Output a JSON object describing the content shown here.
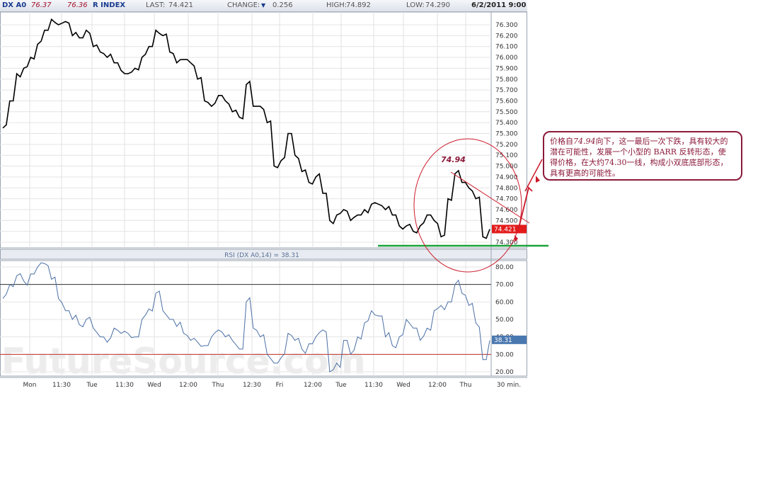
{
  "header": {
    "symbol": "DX A0",
    "value1": "76.37",
    "value2": "76.36",
    "name": "R INDEX",
    "last_label": "LAST:",
    "last_value": "74.421",
    "change_label": "CHANGE:",
    "change_value": "0.256",
    "high_label": "HIGH:",
    "high_value": "74.892",
    "low_label": "LOW:",
    "low_value": "74.290",
    "datetime": "6/2/2011 9:00"
  },
  "rsi_header": "RSI (DX A0,14) = 38.31",
  "watermark": "FutureSource.com",
  "colors": {
    "price_line": "#000000",
    "rsi_line": "#4a6fa5",
    "support_line": "#1aa33a",
    "annotation": "#cc1a2a",
    "rsi_badge": "#4a78b0",
    "price_badge": "#e31b1b"
  },
  "chart_data": [
    {
      "type": "line",
      "series_kind": "price",
      "y_ticks": [
        "76.300",
        "76.200",
        "76.100",
        "76.000",
        "75.900",
        "75.800",
        "75.700",
        "75.600",
        "75.500",
        "75.400",
        "75.300",
        "75.200",
        "75.100",
        "75.000",
        "74.900",
        "74.800",
        "74.700",
        "74.600",
        "74.500",
        "74.400",
        "74.300"
      ],
      "ylim": [
        74.26,
        76.41
      ],
      "last_badge": "74.421",
      "peak_label": "74.94",
      "support_level": 74.3,
      "x_ticks": [
        "Mon",
        "11:30",
        "Tue",
        "11:30",
        "Wed",
        "12:00",
        "Thu",
        "12:30",
        "Fri",
        "12:00",
        "Tue",
        "11:30",
        "Wed",
        "12:00",
        "Thu",
        "30 min."
      ],
      "x": [
        0,
        1,
        2,
        3,
        4,
        5,
        6,
        7,
        8,
        9,
        10,
        11,
        12,
        13,
        14,
        15,
        16,
        17,
        18,
        19,
        20,
        21,
        22,
        23,
        24,
        25,
        26,
        27,
        28,
        29,
        30,
        31,
        32,
        33,
        34,
        35,
        36,
        37,
        38,
        39,
        40,
        41,
        42,
        43,
        44,
        45,
        46,
        47,
        48,
        49,
        50,
        51,
        52,
        53,
        54,
        55,
        56,
        57,
        58,
        59,
        60,
        61,
        62,
        63,
        64,
        65,
        66,
        67,
        68,
        69,
        70
      ],
      "values": [
        75.35,
        75.6,
        75.85,
        75.9,
        76.0,
        76.12,
        76.25,
        76.35,
        76.3,
        76.33,
        76.2,
        76.18,
        76.25,
        76.1,
        76.05,
        76.0,
        75.95,
        75.88,
        75.85,
        75.9,
        76.0,
        76.1,
        76.25,
        76.2,
        76.05,
        75.95,
        75.98,
        75.95,
        75.8,
        75.6,
        75.55,
        75.65,
        75.6,
        75.5,
        75.45,
        75.75,
        75.55,
        75.55,
        75.4,
        75.0,
        75.05,
        75.3,
        75.1,
        74.95,
        74.85,
        74.9,
        74.75,
        74.5,
        74.55,
        74.6,
        74.5,
        74.55,
        74.6,
        74.65,
        74.65,
        74.6,
        74.55,
        74.45,
        74.45,
        74.4,
        74.45,
        74.55,
        74.5,
        74.35,
        74.7,
        74.93,
        74.85,
        74.8,
        74.7,
        74.35,
        74.42
      ]
    },
    {
      "type": "line",
      "series_kind": "rsi",
      "title": "RSI (DX A0,14) = 38.31",
      "y_ticks": [
        "80.00",
        "70.00",
        "60.00",
        "50.00",
        "40.00",
        "30.00",
        "20.00"
      ],
      "ylim": [
        19,
        83
      ],
      "reference_lines": [
        70,
        30
      ],
      "last_badge": "38.31",
      "x": [
        0,
        1,
        2,
        3,
        4,
        5,
        6,
        7,
        8,
        9,
        10,
        11,
        12,
        13,
        14,
        15,
        16,
        17,
        18,
        19,
        20,
        21,
        22,
        23,
        24,
        25,
        26,
        27,
        28,
        29,
        30,
        31,
        32,
        33,
        34,
        35,
        36,
        37,
        38,
        39,
        40,
        41,
        42,
        43,
        44,
        45,
        46,
        47,
        48,
        49,
        50,
        51,
        52,
        53,
        54,
        55,
        56,
        57,
        58,
        59,
        60,
        61,
        62,
        63,
        64,
        65,
        66,
        67,
        68,
        69,
        70
      ],
      "values": [
        62,
        70,
        75,
        72,
        76,
        80,
        82,
        73,
        62,
        55,
        50,
        47,
        50,
        45,
        40,
        37,
        45,
        42,
        42,
        40,
        50,
        56,
        65,
        55,
        50,
        46,
        42,
        38,
        37,
        35,
        40,
        44,
        40,
        38,
        33,
        60,
        45,
        40,
        30,
        25,
        28,
        42,
        38,
        33,
        36,
        40,
        44,
        20,
        25,
        38,
        30,
        40,
        48,
        55,
        52,
        40,
        35,
        40,
        50,
        45,
        38,
        45,
        55,
        58,
        60,
        70,
        65,
        58,
        48,
        27,
        38
      ]
    }
  ],
  "annotation": {
    "line1_pre": "价格自",
    "line1_num": "74.94",
    "line1_post": "向下，这一最后一次下跌，具有较大的",
    "line2": "潜在可能性，发展一个小型的 BARR 反转形态，使",
    "line3": "得价格，在大约74.30一线，构成小双底底部形态，",
    "line4": "具有更高的可能性。"
  }
}
